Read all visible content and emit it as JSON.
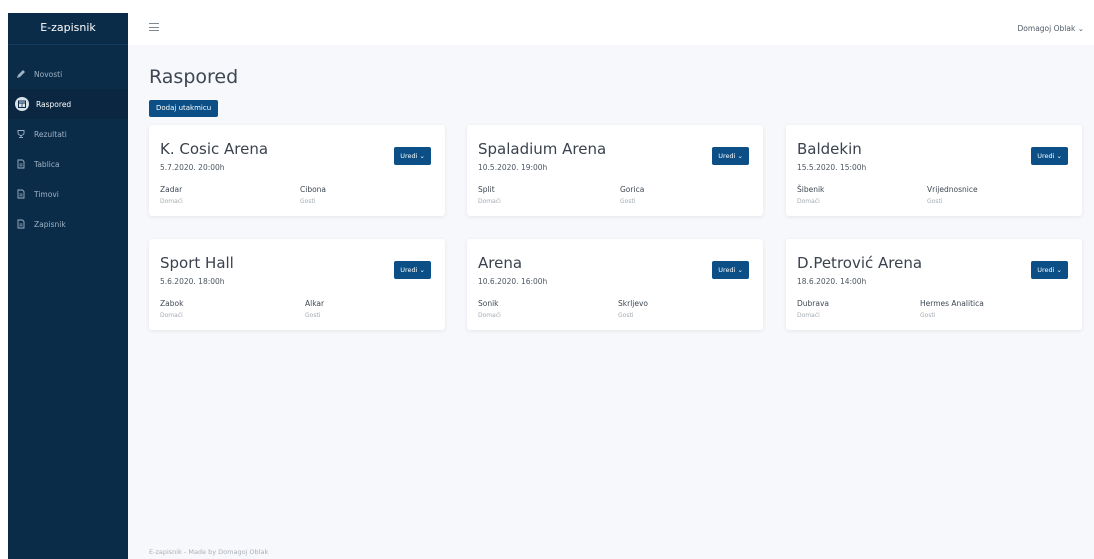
{
  "app": {
    "brand": "E-zapisnik"
  },
  "sidebar": {
    "items": [
      {
        "label": "Novosti",
        "icon": "pencil-icon",
        "active": false
      },
      {
        "label": "Raspored",
        "icon": "calendar-icon",
        "active": true
      },
      {
        "label": "Rezultati",
        "icon": "trophy-icon",
        "active": false
      },
      {
        "label": "Tablica",
        "icon": "document-icon",
        "active": false
      },
      {
        "label": "Timovi",
        "icon": "document-icon",
        "active": false
      },
      {
        "label": "Zapisnik",
        "icon": "document-icon",
        "active": false
      }
    ]
  },
  "topbar": {
    "user": "Domagoj Oblak"
  },
  "page": {
    "title": "Raspored",
    "add_button": "Dodaj utakmicu",
    "edit_label": "Uredi",
    "home_role": "Domaći",
    "away_role": "Gosti"
  },
  "matches": [
    {
      "arena": "K. Cosic Arena",
      "datetime": "5.7.2020. 20:00h",
      "home": "Zadar",
      "away": "Cibona"
    },
    {
      "arena": "Spaladium Arena",
      "datetime": "10.5.2020. 19:00h",
      "home": "Split",
      "away": "Gorica"
    },
    {
      "arena": "Baldekin",
      "datetime": "15.5.2020. 15:00h",
      "home": "Šibenik",
      "away": "Vrijednosnice"
    },
    {
      "arena": "Sport Hall",
      "datetime": "5.6.2020. 18:00h",
      "home": "Zabok",
      "away": "Alkar"
    },
    {
      "arena": "Arena",
      "datetime": "10.6.2020. 16:00h",
      "home": "Sonik",
      "away": "Skrljevo"
    },
    {
      "arena": "D.Petrović Arena",
      "datetime": "18.6.2020. 14:00h",
      "home": "Dubrava",
      "away": "Hermes Analitica"
    }
  ],
  "footer": "E-zapisnik - Made by Domagoj Oblak",
  "colors": {
    "sidebar": "#0b2c49",
    "accent": "#0b4f86",
    "background": "#f7f8fb"
  }
}
